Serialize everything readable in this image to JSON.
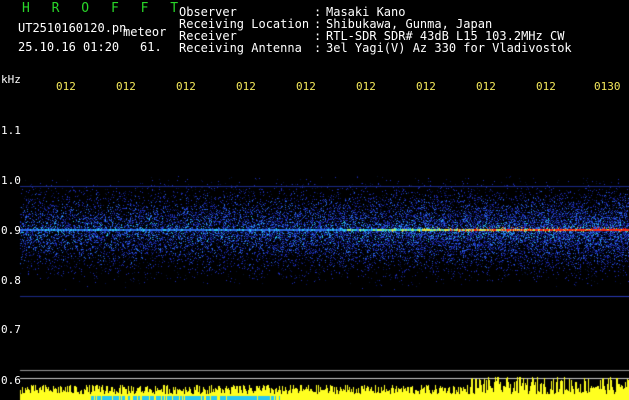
{
  "app": {
    "name": "H R O F F T"
  },
  "file": {
    "name": "UT2510160120.pn",
    "mode": "meteor",
    "datetime": "25.10.16 01:20",
    "value": "61."
  },
  "info": [
    {
      "label": "Observer",
      "sep": ":",
      "value": "Masaki Kano"
    },
    {
      "label": "Receiving Location",
      "sep": ":",
      "value": "Shibukawa, Gunma, Japan"
    },
    {
      "label": "Receiver",
      "sep": ":",
      "value": "RTL-SDR SDR# 43dB L15 103.2MHz CW"
    },
    {
      "label": "Receiving Antenna",
      "sep": ":",
      "value": "3el Yagi(V) Az 330 for Vladivostok"
    }
  ],
  "axis": {
    "unit": "kHz",
    "y_ticks": [
      "1.1",
      "1.0",
      "0.9",
      "0.8",
      "0.7",
      "0.6"
    ],
    "time_ticks": [
      "012",
      "012",
      "012",
      "012",
      "012",
      "012",
      "012",
      "012",
      "012",
      "0130"
    ]
  },
  "colors": {
    "title": "#29d629",
    "text": "#ffffff",
    "ticks": "#f2e65a",
    "signal_peak": "#ff2a10",
    "noise": "#1e2eb8",
    "level_bar": "#ffff20",
    "level_low": "#28c8f0"
  }
}
